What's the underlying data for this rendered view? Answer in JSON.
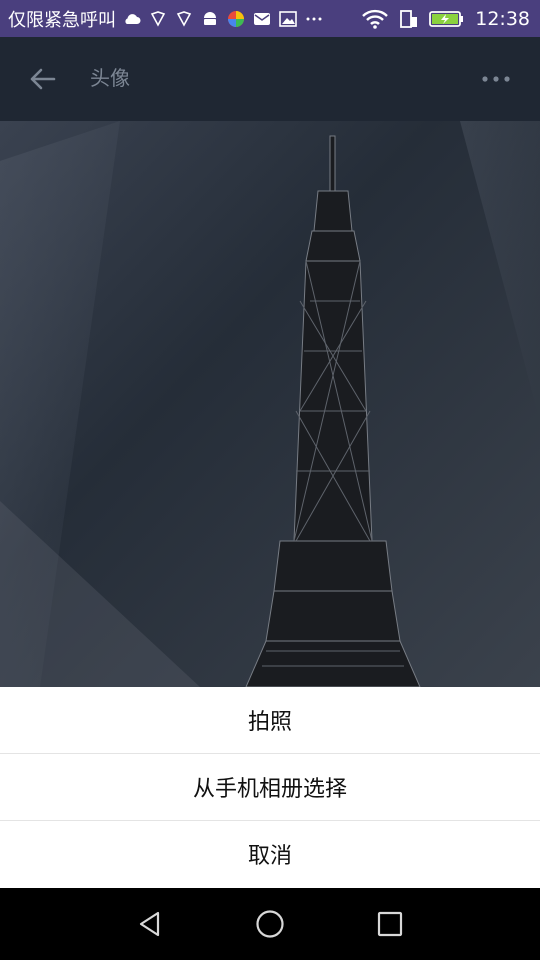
{
  "status_bar": {
    "carrier_text": "仅限紧急呼叫",
    "time": "12:38",
    "icons": [
      "cloud-icon",
      "shield-icon",
      "shield-icon",
      "android-icon",
      "pinwheel-icon",
      "mail-icon",
      "image-icon",
      "more-dots-icon",
      "wifi-icon",
      "sim-icon",
      "battery-charging-icon"
    ]
  },
  "app_bar": {
    "title": "头像",
    "back_icon": "back-arrow-icon",
    "menu_icon": "more-dots-icon"
  },
  "photo": {
    "subject": "eiffel-tower"
  },
  "action_sheet": {
    "items": [
      {
        "label": "拍照"
      },
      {
        "label": "从手机相册选择"
      },
      {
        "label": "取消"
      }
    ]
  },
  "nav_bar": {
    "icons": [
      "back-triangle-icon",
      "home-circle-icon",
      "recents-square-icon"
    ]
  },
  "colors": {
    "status_bar": "#4a3f7e",
    "app_bar": "#1f2733",
    "sheet": "#ffffff"
  }
}
